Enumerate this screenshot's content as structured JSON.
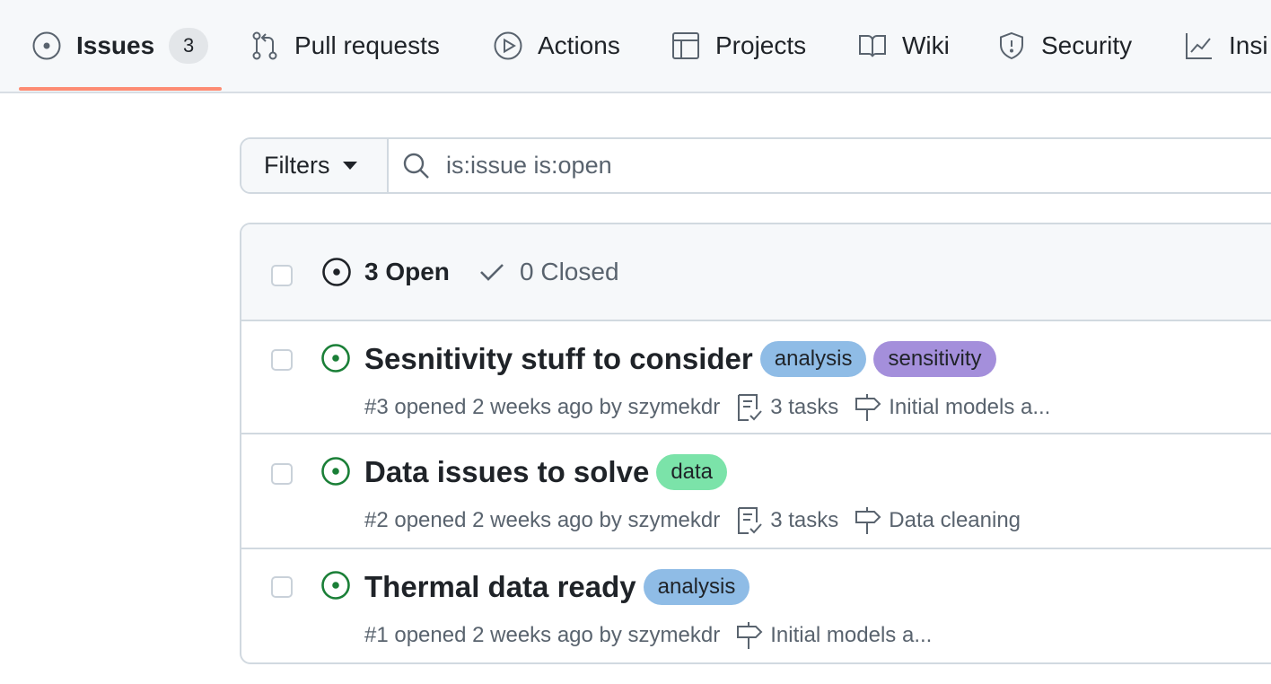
{
  "nav": {
    "tabs": [
      {
        "label": "Issues",
        "counter": "3",
        "icon": "issue-opened-icon",
        "active": true
      },
      {
        "label": "Pull requests",
        "icon": "git-pull-request-icon"
      },
      {
        "label": "Actions",
        "icon": "play-icon"
      },
      {
        "label": "Projects",
        "icon": "table-icon"
      },
      {
        "label": "Wiki",
        "icon": "book-icon"
      },
      {
        "label": "Security",
        "icon": "shield-icon"
      },
      {
        "label": "Insi",
        "icon": "graph-icon"
      }
    ]
  },
  "filterbar": {
    "filters_label": "Filters",
    "search_value": "is:issue is:open"
  },
  "list": {
    "open_label": "3 Open",
    "closed_label": "0 Closed",
    "issues": [
      {
        "title": "Sesnitivity stuff to consider",
        "labels": [
          {
            "text": "analysis",
            "color": "#8fbce6"
          },
          {
            "text": "sensitivity",
            "color": "#a48fdb"
          }
        ],
        "meta": "#3 opened 2 weeks ago by szymekdr",
        "tasks": "3 tasks",
        "milestone": "Initial models a..."
      },
      {
        "title": "Data issues to solve",
        "labels": [
          {
            "text": "data",
            "color": "#7be3a9"
          }
        ],
        "meta": "#2 opened 2 weeks ago by szymekdr",
        "tasks": "3 tasks",
        "milestone": "Data cleaning"
      },
      {
        "title": "Thermal data ready",
        "labels": [
          {
            "text": "analysis",
            "color": "#8fbce6"
          }
        ],
        "meta": "#1 opened 2 weeks ago by szymekdr",
        "milestone": "Initial models a..."
      }
    ]
  },
  "colors": {
    "open_green": "#1a7f37",
    "active_underline": "#fd8c73"
  }
}
